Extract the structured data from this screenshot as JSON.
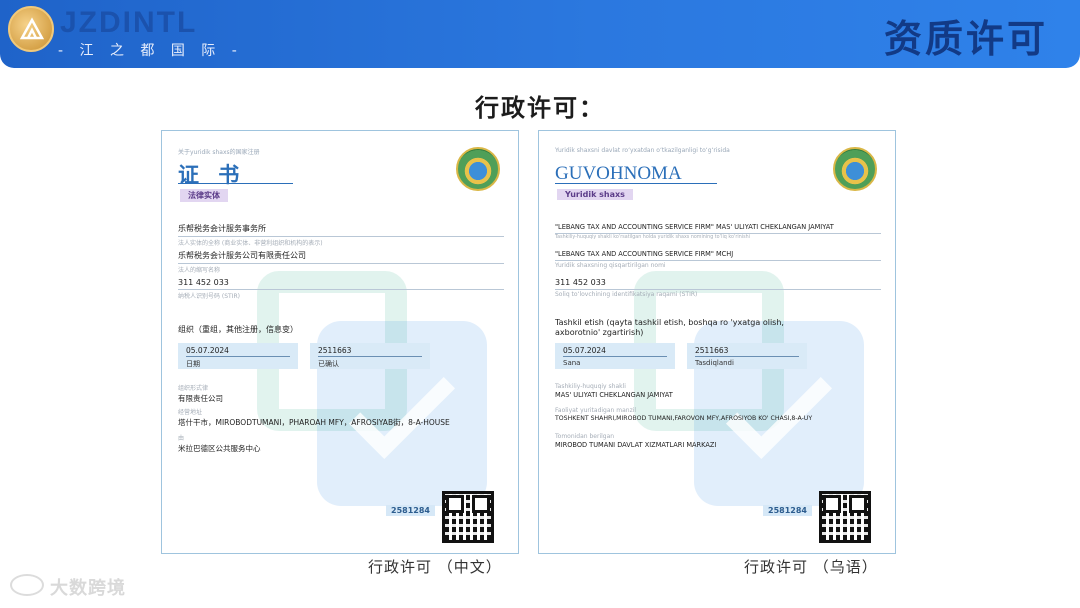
{
  "header": {
    "logo_en": "JZDINTL",
    "logo_cn": "- 江 之 都 国 际 -",
    "title": "资质许可"
  },
  "section_title": "行政许可：",
  "cert_cn": {
    "tiny_header": "关于yuridik shaxs的国家注册",
    "title": "证 书",
    "entity_tag": "法律实体",
    "fields": [
      {
        "value": "乐帮税务会计服务事务所",
        "label": "法人实体的全称 (商业实体、非营利组织和机构的表示)"
      },
      {
        "value": "乐帮税务会计服务公司有限责任公司",
        "label": "法人的缩写名称"
      },
      {
        "value": "311 452 033",
        "label": "纳税人识别号码 (STIR)"
      }
    ],
    "org_head": "组织（重组，其他注册，信息变）",
    "box1": {
      "value": "05.07.2024",
      "label": "日期"
    },
    "box2": {
      "value": "2511663",
      "label": "已确认"
    },
    "items": [
      {
        "label": "组织形式律",
        "value": "有限责任公司"
      },
      {
        "label": "经营地址",
        "value": "塔什干市，MIROBODTUMANI，PHAROAH MFY，AFROSIYAB街，8-A-HOUSE"
      },
      {
        "label": "由",
        "value": "米拉巴德区公共服务中心"
      }
    ],
    "badge": "2581284",
    "caption": "行政许可 （中文）"
  },
  "cert_uz": {
    "tiny_header": "Yuridik shaxsni davlat ro‘yxatdan o‘tkazilganligi to‘g‘risida",
    "title": "GUVOHNOMA",
    "entity_tag": "Yuridik shaxs",
    "fields": [
      {
        "value": "\"LEBANG TAX AND ACCOUNTING SERVICE FIRM\" MAS' ULIYATI CHEKLANGAN JAMIYAT",
        "label": "Tashkiliy-huquqiy shakli ko‘rsatilgan holda yuridik shaxs nomining to‘liq ko‘rinishi"
      },
      {
        "value": "\"LEBANG TAX AND ACCOUNTING SERVICE FIRM\" MCHJ",
        "label": "Yuridik shaxsning qisqartirilgan nomi"
      },
      {
        "value": "311 452 033",
        "label": "Soliq to‘lovchining identifikatsiya raqami (STIR)"
      }
    ],
    "org_head": "Tashkil etish (qayta tashkil etish, boshqa ro 'yxatga olish, axborotnio' zgartirish)",
    "box1": {
      "value": "05.07.2024",
      "label": "Sana"
    },
    "box2": {
      "value": "2511663",
      "label": "Tasdiqlandi"
    },
    "items": [
      {
        "label": "Tashkiliy-huquqiy shakli",
        "value": "MAS' ULIYATI CHEKLANGAN JAMIYAT"
      },
      {
        "label": "Faoliyat yuritadigan manzil",
        "value": "TOSHKENT SHAHRI,MIROBOD TUMANI,FAROVON MFY,AFROSIYOB KO' CHASI,8-A-UY"
      },
      {
        "label": "Tomonidan berilgan",
        "value": "MIROBOD TUMANI DAVLAT XIZMATLARI MARKAZI"
      }
    ],
    "badge": "2581284",
    "caption": "行政许可 （乌语）"
  },
  "footer": {
    "brand": "大数跨境"
  },
  "colors": {
    "header_blue": "#2b78df",
    "title_blue": "#123a86",
    "cert_accent": "#2b6fb9"
  }
}
